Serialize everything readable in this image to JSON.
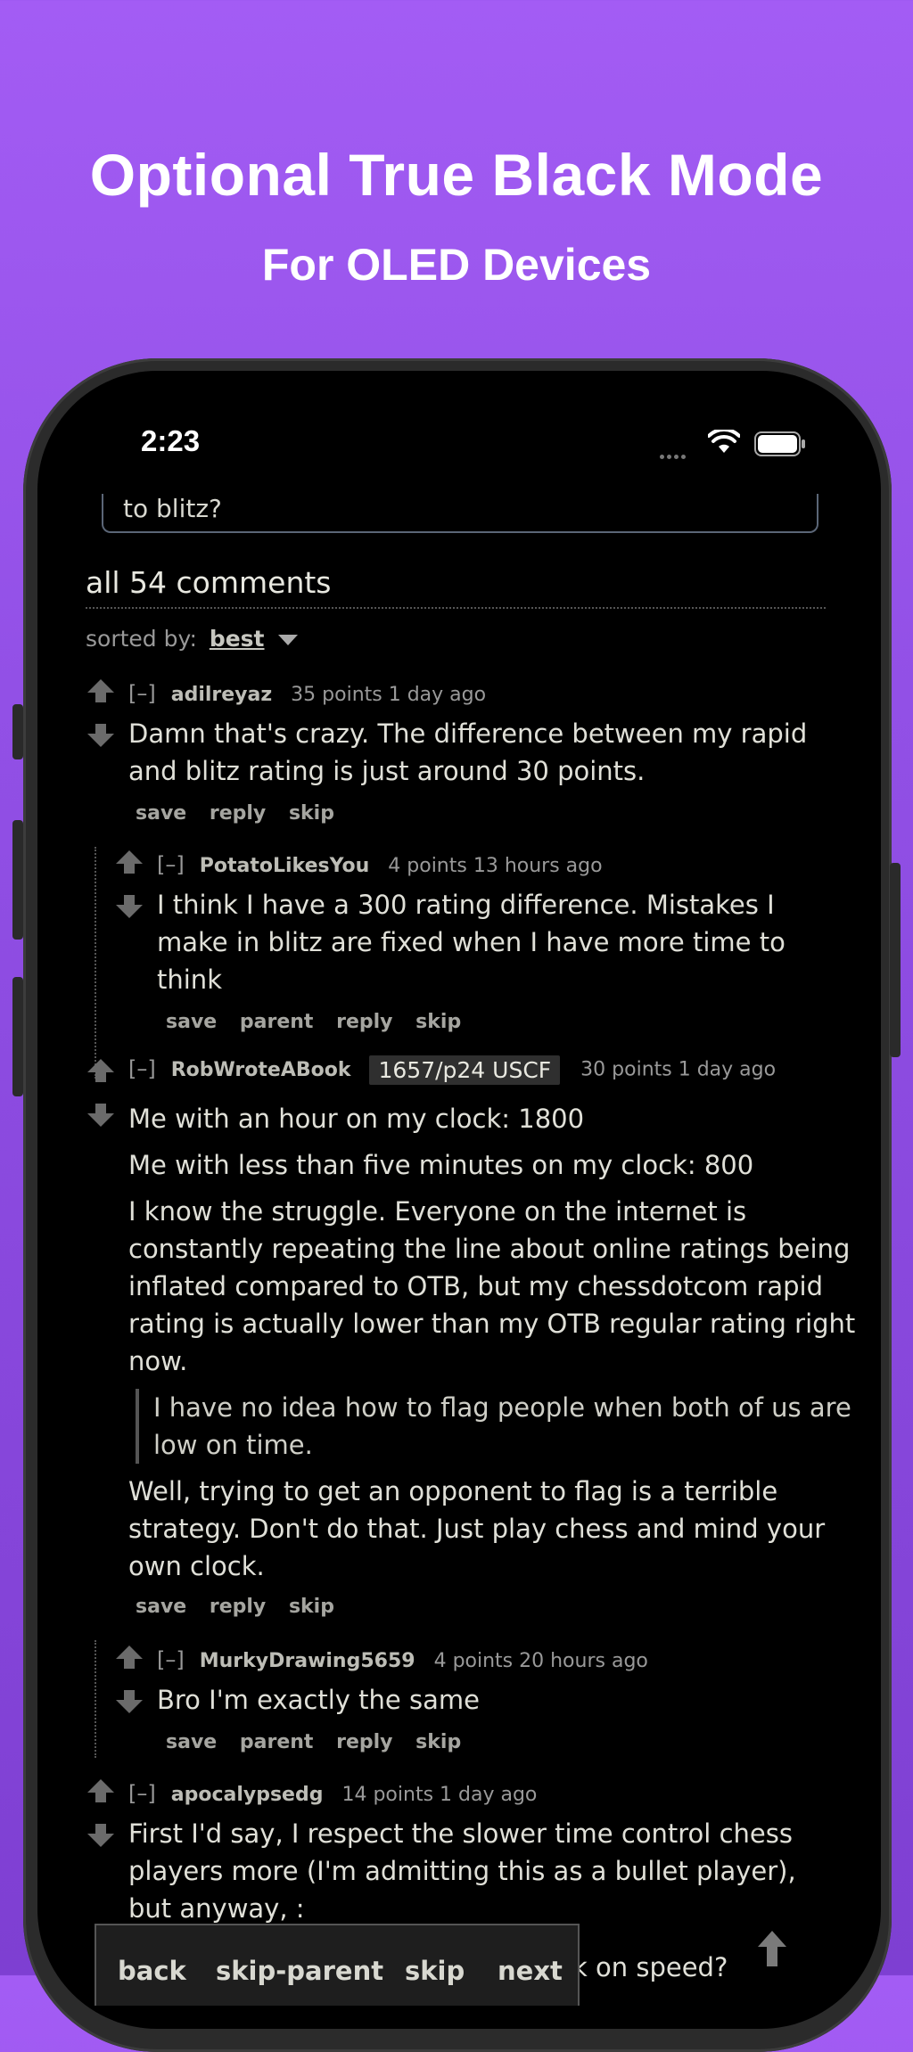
{
  "promo": {
    "title": "Optional True Black Mode",
    "subtitle": "For OLED Devices"
  },
  "status_bar": {
    "time": "2:23"
  },
  "post": {
    "title_fragment": "to blitz?"
  },
  "comments_header": "all 54 comments",
  "sort": {
    "label": "sorted by:",
    "value": "best"
  },
  "comments": [
    {
      "collapse": "[–]",
      "author": "adilreyaz",
      "meta": "35 points 1 day ago",
      "lines": [
        "Damn that's crazy. The difference between my rapid and blitz rating is just around 30 points."
      ],
      "actions": [
        "save",
        "reply",
        "skip"
      ]
    },
    {
      "collapse": "[–]",
      "author": "PotatoLikesYou",
      "meta": "4 points 13 hours ago",
      "lines": [
        "I think I have a 300 rating difference. Mistakes I make in blitz are fixed when I have more time to think"
      ],
      "actions": [
        "save",
        "parent",
        "reply",
        "skip"
      ]
    },
    {
      "collapse": "[–]",
      "author": "RobWroteABook",
      "flair": "1657/p24 USCF",
      "meta": "30 points 1 day ago",
      "lines": [
        "Me with an hour on my clock: 1800",
        "Me with less than five minutes on my clock: 800",
        "I know the struggle. Everyone on the internet is constantly repeating the line about online ratings being inflated compared to OTB, but my chessdotcom rapid rating is actually lower than my OTB regular rating right now."
      ],
      "quote": "I have no idea how to flag people when both of us are low on time.",
      "after_quote": "Well, trying to get an opponent to flag is a terrible strategy. Don't do that. Just play chess and mind your own clock.",
      "actions": [
        "save",
        "reply",
        "skip"
      ]
    },
    {
      "collapse": "[–]",
      "author": "MurkyDrawing5659",
      "meta": "4 points 20 hours ago",
      "lines": [
        "Bro I'm exactly the same"
      ],
      "actions": [
        "save",
        "parent",
        "reply",
        "skip"
      ]
    },
    {
      "collapse": "[–]",
      "author": "apocalypsedg",
      "meta": "14 points 1 day ago",
      "lines": [
        "First I'd say, I respect the slower time control chess players more (I'm admitting this as a bullet player), but anyway, :"
      ]
    }
  ],
  "hidden_text_fragment": "k on speed?",
  "bottom_nav": {
    "back": "back",
    "skip_parent": "skip-parent",
    "skip": "skip",
    "next": "next"
  },
  "colors": {
    "background_top": "#a35cf4",
    "background_bottom": "#7e3fd2",
    "screen": "#000000"
  },
  "icons": [
    "upvote-arrow-icon",
    "downvote-arrow-icon",
    "wifi-icon",
    "battery-icon",
    "scroll-to-top-icon",
    "dropdown-caret-icon"
  ]
}
